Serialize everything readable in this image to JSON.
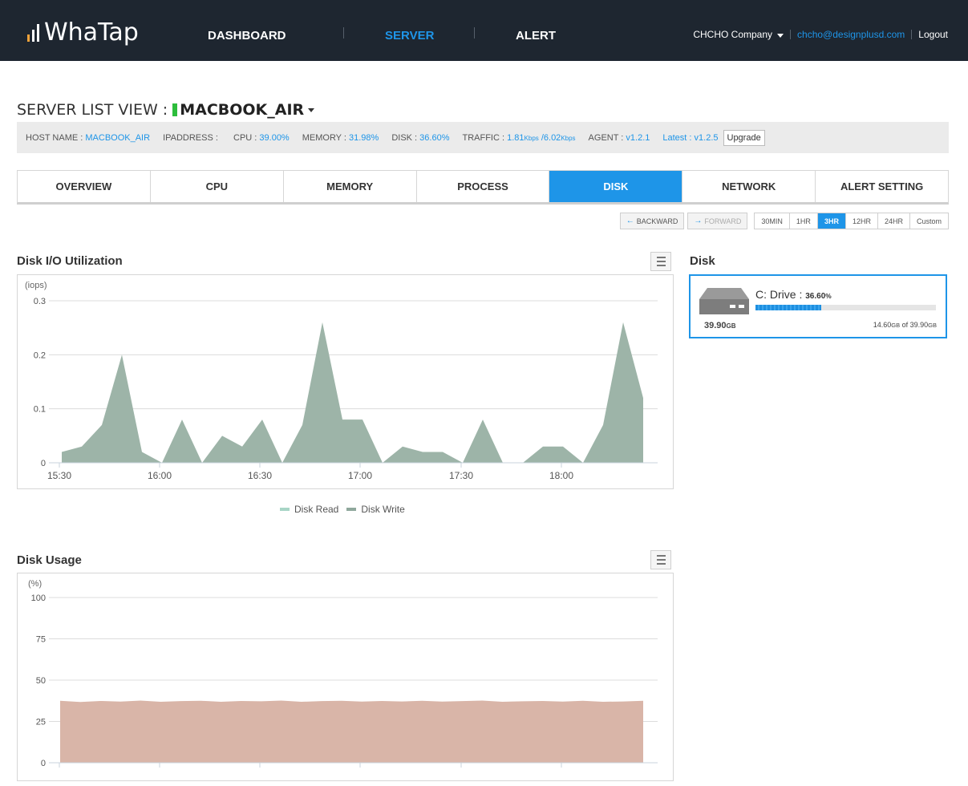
{
  "brand": {
    "logo_text": "WhaTap",
    "accent_color": "#1e95e8",
    "topbar_color": "#1e2630"
  },
  "nav": {
    "items": [
      {
        "label": "DASHBOARD",
        "active": false
      },
      {
        "label": "SERVER",
        "active": true
      },
      {
        "label": "ALERT",
        "active": false
      }
    ]
  },
  "user": {
    "company": "CHCHO Company",
    "email": "chcho@designplusd.com",
    "logout": "Logout"
  },
  "server": {
    "title_prefix": "SERVER LIST VIEW :",
    "name": "MACBOOK_AIR",
    "status_color": "#2dbd3c",
    "info": {
      "host_label": "HOST NAME :",
      "host_value": "MACBOOK_AIR",
      "ip_label": "IPADDRESS :",
      "ip_value": "",
      "cpu_label": "CPU :",
      "cpu_value": "39.00%",
      "memory_label": "MEMORY :",
      "memory_value": "31.98%",
      "disk_label": "DISK :",
      "disk_value": "36.60%",
      "traffic_label": "TRAFFIC :",
      "traffic_in": "1.81",
      "traffic_in_unit": "Kbps",
      "traffic_sep": " /",
      "traffic_out": "6.02",
      "traffic_out_unit": "Kbps",
      "agent_label": "AGENT :",
      "agent_value": "v1.2.1",
      "latest_label": "Latest :",
      "latest_value": "v1.2.5",
      "upgrade_label": "Upgrade"
    }
  },
  "tabs": [
    {
      "label": "OVERVIEW",
      "active": false
    },
    {
      "label": "CPU",
      "active": false
    },
    {
      "label": "MEMORY",
      "active": false
    },
    {
      "label": "PROCESS",
      "active": false
    },
    {
      "label": "DISK",
      "active": true
    },
    {
      "label": "NETWORK",
      "active": false
    },
    {
      "label": "ALERT SETTING",
      "active": false
    }
  ],
  "time_controls": {
    "backward": "BACKWARD",
    "backward_icon": "arrow-left-icon",
    "forward": "FORWARD",
    "forward_icon": "arrow-right-icon",
    "ranges": [
      {
        "label": "30MIN",
        "active": false
      },
      {
        "label": "1HR",
        "active": false
      },
      {
        "label": "3HR",
        "active": true
      },
      {
        "label": "12HR",
        "active": false
      },
      {
        "label": "24HR",
        "active": false
      },
      {
        "label": "Custom",
        "active": false
      }
    ]
  },
  "panels": {
    "io_title": "Disk I/O Utilization",
    "usage_title": "Disk Usage",
    "disk_title": "Disk",
    "menu_icon": "hamburger-menu-icon"
  },
  "legend": {
    "read": "Disk Read",
    "write": "Disk Write",
    "read_color": "#a8d5c6",
    "write_color": "#8fa89c"
  },
  "disk_card": {
    "drive_label": "C: Drive :",
    "percent": "36.60",
    "percent_unit": "%",
    "fraction": 0.366,
    "size_value": "39.90",
    "size_unit": "GB",
    "used_value": "14.60",
    "used_unit": "GB",
    "of_text": " of ",
    "total_value": "39.90",
    "total_unit": "GB",
    "icon": "hard-drive-icon"
  },
  "chart_data": [
    {
      "type": "area",
      "title": "Disk I/O Utilization",
      "ylabel": "(iops)",
      "ylim": [
        0,
        0.3
      ],
      "yticks": [
        "0",
        "0.1",
        "0.2",
        "0.3"
      ],
      "xticks": [
        "15:30",
        "16:00",
        "16:30",
        "17:00",
        "17:30",
        "18:00"
      ],
      "x": [
        "15:30",
        "15:35",
        "15:40",
        "15:45",
        "15:50",
        "15:55",
        "16:00",
        "16:05",
        "16:10",
        "16:15",
        "16:20",
        "16:25",
        "16:30",
        "16:35",
        "16:40",
        "16:45",
        "16:50",
        "16:55",
        "17:00",
        "17:05",
        "17:10",
        "17:15",
        "17:20",
        "17:25",
        "17:30",
        "17:35",
        "17:40",
        "17:45",
        "17:50",
        "17:55",
        "18:00",
        "18:05",
        "18:10",
        "18:15",
        "18:20",
        "18:25"
      ],
      "series": [
        {
          "name": "Disk Write",
          "color": "#9db4a8",
          "values": [
            0.02,
            0.03,
            0.07,
            0.2,
            0.02,
            0,
            0.08,
            0,
            0.05,
            0.03,
            0.08,
            0,
            0.07,
            0.26,
            0.08,
            0.08,
            0,
            0.03,
            0.02,
            0.02,
            0,
            0.08,
            0,
            0,
            0.03,
            0.03,
            0,
            0.07,
            0.26,
            0.12
          ]
        },
        {
          "name": "Disk Read",
          "color": "#a8d5c6",
          "values": []
        }
      ],
      "grid": true
    },
    {
      "type": "area",
      "title": "Disk Usage",
      "ylabel": "(%)",
      "ylim": [
        0,
        100
      ],
      "yticks": [
        "0",
        "25",
        "50",
        "75",
        "100"
      ],
      "series": [
        {
          "name": "Disk Usage",
          "color": "#d9b5a8",
          "values": [
            37.5,
            36.8,
            37.4,
            37,
            37.6,
            36.9,
            37.3,
            37.5,
            36.9,
            37.4,
            37.2,
            37.6,
            36.9,
            37.3,
            37.5,
            37,
            37.4,
            37.1,
            37.5,
            37,
            37.3,
            37.6,
            36.9,
            37.2,
            37.4,
            37,
            37.5,
            36.9,
            37.1,
            37.5
          ]
        }
      ],
      "grid": true
    }
  ]
}
